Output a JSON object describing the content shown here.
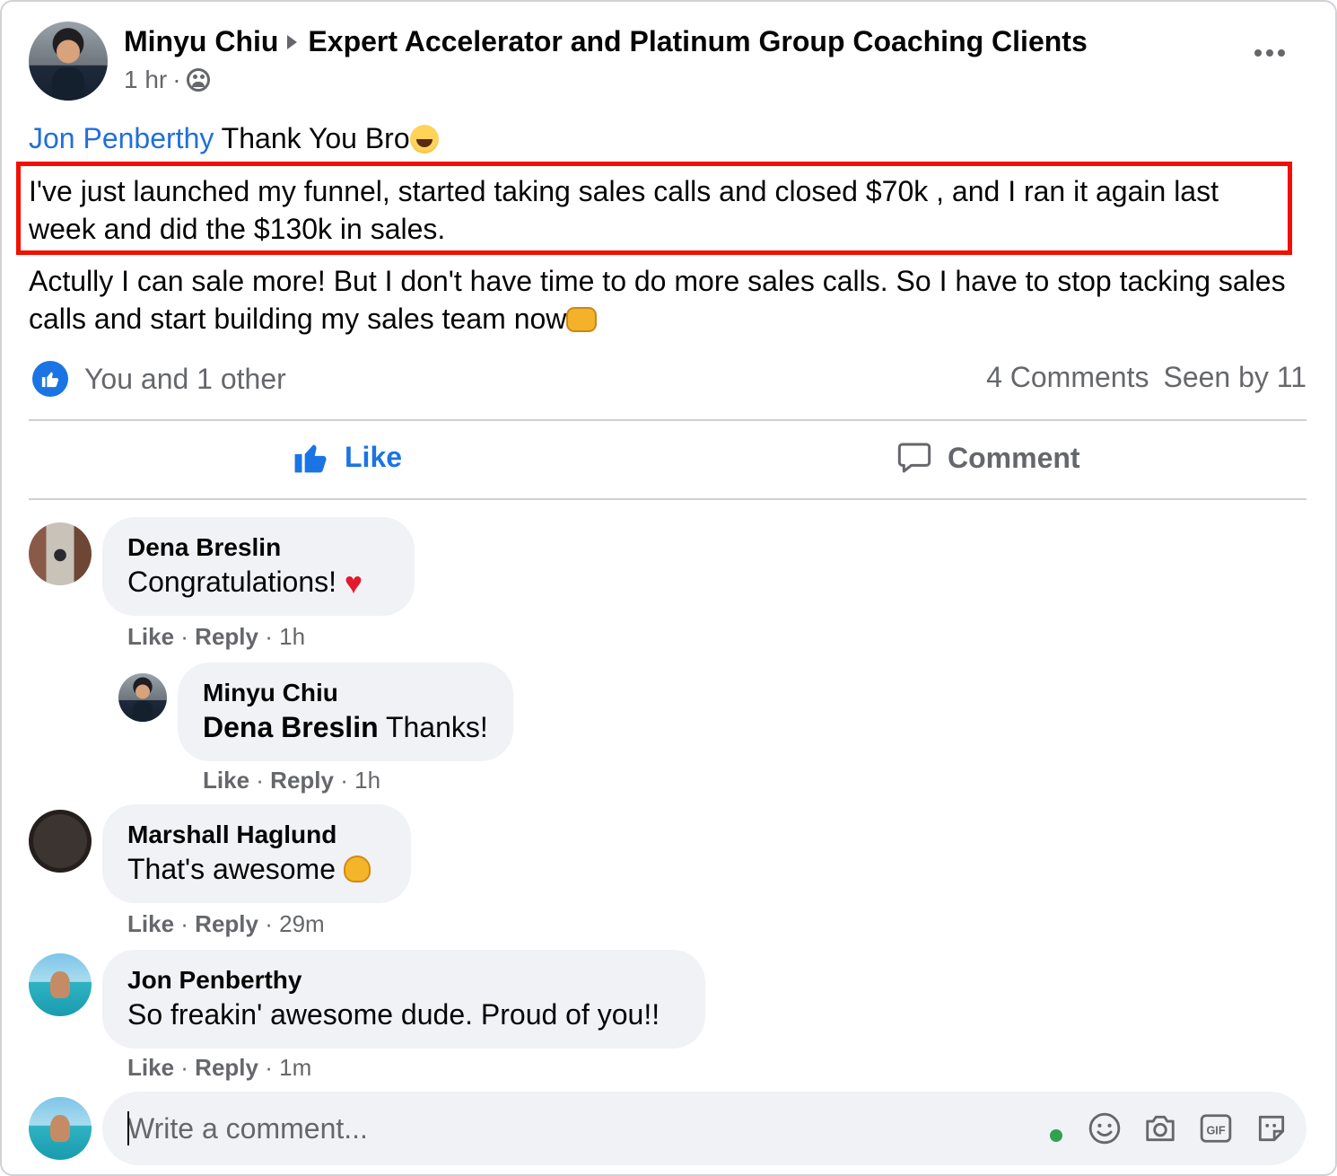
{
  "post": {
    "author": "Minyu Chiu",
    "group": "Expert Accelerator and Platinum Group Coaching Clients",
    "time": "1 hr",
    "dot": "·",
    "mention": "Jon Penberthy",
    "greeting": " Thank You Bro",
    "highlighted_text": "I've just launched my funnel, started taking sales calls and closed $70k , and I ran it again last week and did the $130k in sales.",
    "paragraph": "Actully I can sale more! But I don't have time to do more sales calls. So I have to stop tacking sales calls and start building my sales team now",
    "highlight_color": "#f20f00"
  },
  "stats": {
    "reactions": "You and 1 other",
    "comments": "4 Comments",
    "seen": "Seen by 11"
  },
  "actions": {
    "like": "Like",
    "comment": "Comment",
    "like_color": "#1b74e4"
  },
  "comments": [
    {
      "name": "Dena Breslin",
      "text": "Congratulations! ",
      "like": "Like",
      "reply": "Reply",
      "time": "1h",
      "dot": "·"
    },
    {
      "name": "Minyu Chiu",
      "mention": "Dena Breslin",
      "text": " Thanks!",
      "like": "Like",
      "reply": "Reply",
      "time": "1h",
      "dot": "·"
    },
    {
      "name": "Marshall Haglund",
      "text": "That's awesome ",
      "like": "Like",
      "reply": "Reply",
      "time": "29m",
      "dot": "·"
    },
    {
      "name": "Jon Penberthy",
      "text": "So freakin' awesome dude. Proud of you!!",
      "like": "Like",
      "reply": "Reply",
      "time": "1m",
      "dot": "·"
    }
  ],
  "composer": {
    "placeholder": "Write a comment...",
    "icons": [
      "emoji-icon",
      "camera-icon",
      "gif-icon",
      "sticker-icon"
    ]
  },
  "icons": {
    "more": "more-options-icon",
    "audience": "group-audience-icon",
    "like_badge": "like-badge-icon"
  }
}
